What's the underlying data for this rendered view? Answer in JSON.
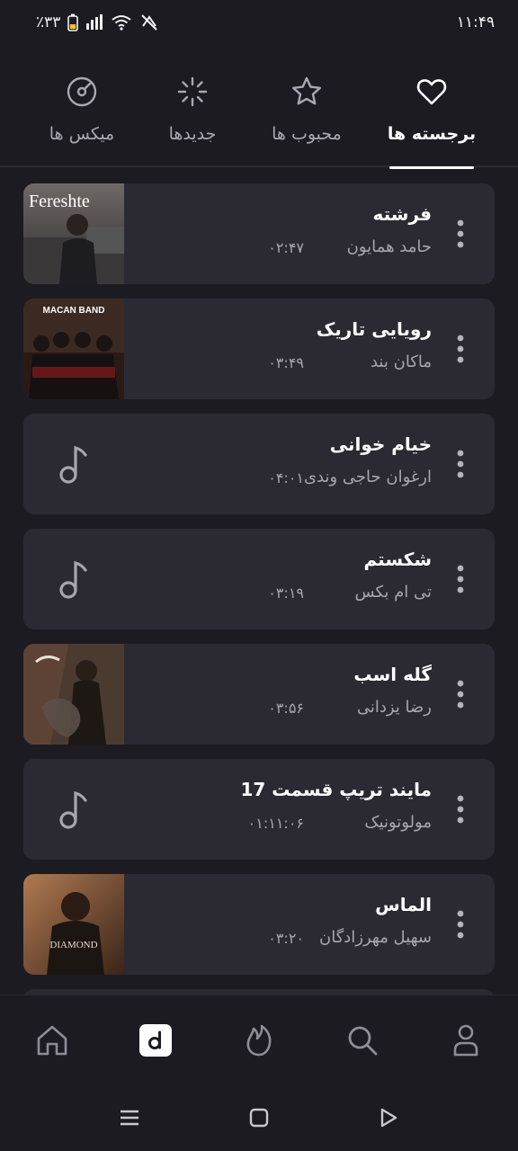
{
  "status_bar": {
    "time": "۱۱:۴۹",
    "battery": "٪۳۳"
  },
  "tabs": [
    {
      "label": "میکس ها",
      "icon": "disc-icon",
      "active": false
    },
    {
      "label": "جدیدها",
      "icon": "sparkle-loading-icon",
      "active": false
    },
    {
      "label": "محبوب ها",
      "icon": "star-icon",
      "active": false
    },
    {
      "label": "برجسته ها",
      "icon": "heart-icon",
      "active": true
    }
  ],
  "songs": [
    {
      "title": "فرشته",
      "artist": "حامد همایون",
      "duration": "۰۲:۴۷",
      "cover": "Fereshte"
    },
    {
      "title": "رویایی تاریک",
      "artist": "ماکان بند",
      "duration": "۰۳:۴۹",
      "cover": "MACAN BAND"
    },
    {
      "title": "خیام خوانی",
      "artist": "ارغوان حاجی وندی",
      "duration": "۰۴:۰۱",
      "cover": ""
    },
    {
      "title": "شکستم",
      "artist": "تی ام بکس",
      "duration": "۰۳:۱۹",
      "cover": ""
    },
    {
      "title": "گله اسب",
      "artist": "رضا یزدانی",
      "duration": "۰۳:۵۶",
      "cover": "art"
    },
    {
      "title": "مایند تریپ قسمت 17",
      "artist": "مولوتونیک",
      "duration": "۰۱:۱۱:۰۶",
      "cover": ""
    },
    {
      "title": "الماس",
      "artist": "سهیل مهرزادگان",
      "duration": "۰۳:۲۰",
      "cover": "DIAMOND"
    }
  ],
  "bottom_nav": [
    {
      "icon": "home-icon"
    },
    {
      "icon": "app-logo-icon",
      "active": true
    },
    {
      "icon": "flame-icon"
    },
    {
      "icon": "search-icon"
    },
    {
      "icon": "profile-icon"
    }
  ],
  "colors": {
    "background": "#1c1b22",
    "card": "#2b2a33",
    "muted_text": "#a7a6b0"
  }
}
